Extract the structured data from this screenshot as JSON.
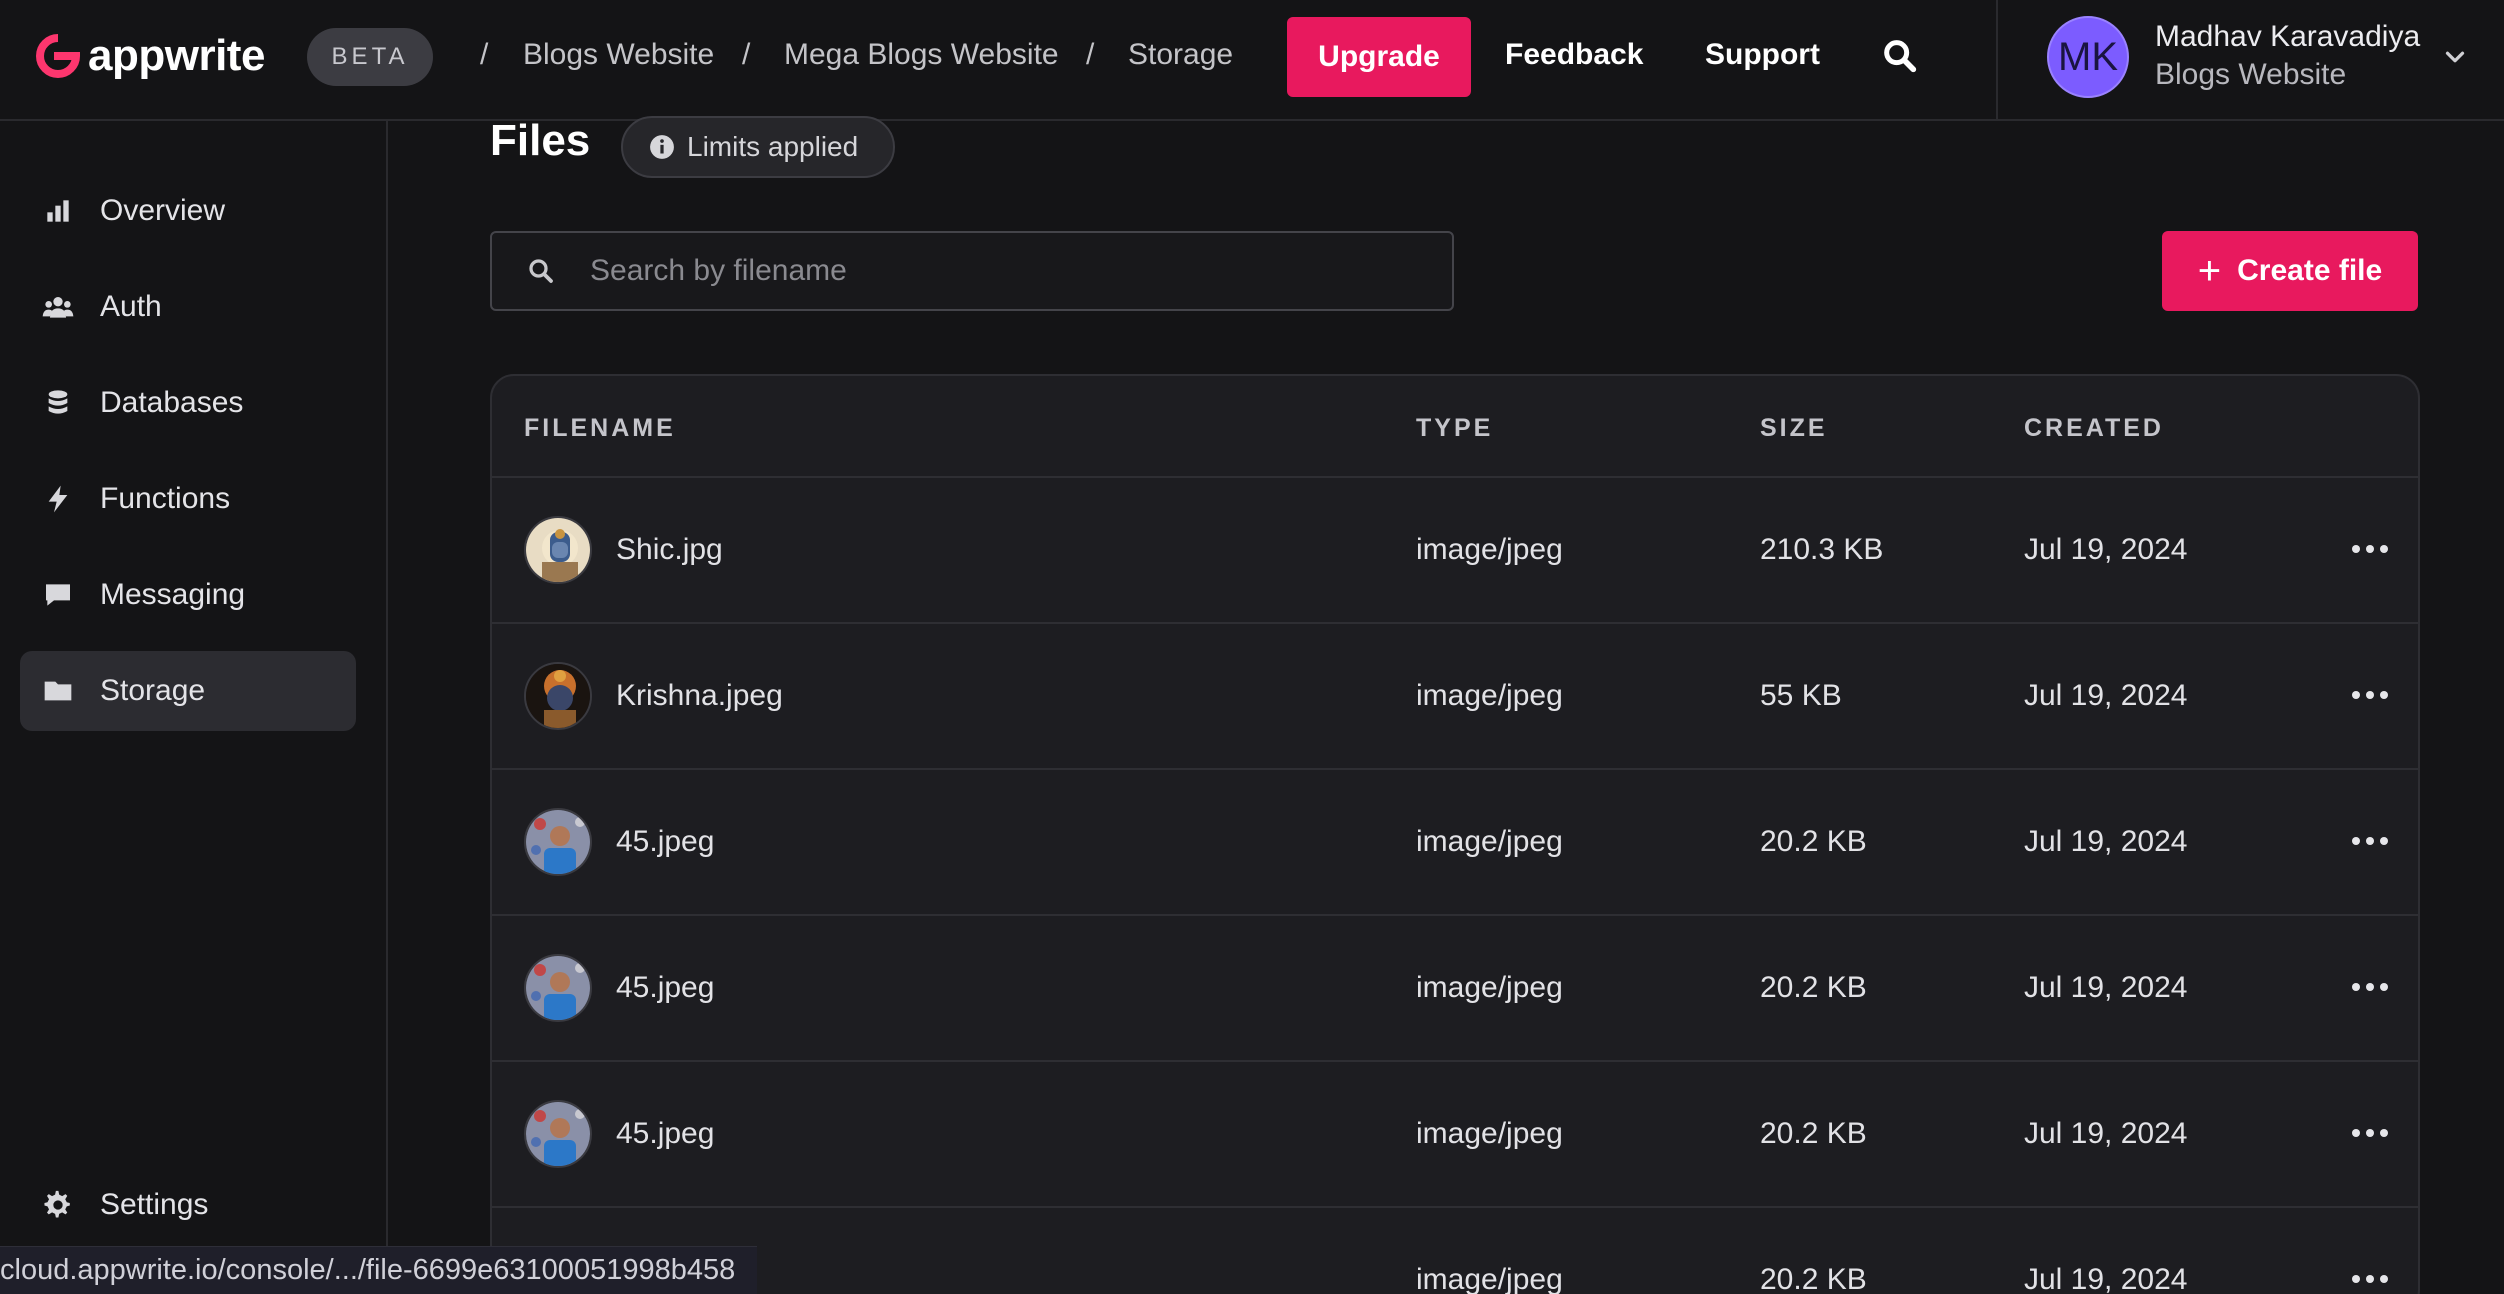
{
  "header": {
    "logo_text": "appwrite",
    "beta_label": "BETA",
    "breadcrumbs": [
      "Blogs Website",
      "Mega Blogs Website",
      "Storage"
    ],
    "upgrade_label": "Upgrade",
    "feedback_label": "Feedback",
    "support_label": "Support",
    "user": {
      "initials": "MK",
      "name": "Madhav Karavadiya",
      "project": "Blogs Website"
    }
  },
  "sidebar": {
    "items": [
      {
        "label": "Overview",
        "icon": "chart-bar-icon"
      },
      {
        "label": "Auth",
        "icon": "users-icon"
      },
      {
        "label": "Databases",
        "icon": "database-icon"
      },
      {
        "label": "Functions",
        "icon": "lightning-icon"
      },
      {
        "label": "Messaging",
        "icon": "chat-icon"
      },
      {
        "label": "Storage",
        "icon": "folder-icon",
        "active": true
      }
    ],
    "settings_label": "Settings"
  },
  "main": {
    "title": "Files",
    "limits_label": "Limits applied",
    "search_placeholder": "Search by filename",
    "create_label": "Create file",
    "columns": [
      "FILENAME",
      "TYPE",
      "SIZE",
      "CREATED"
    ],
    "rows": [
      {
        "name": "Shic.jpg",
        "type": "image/jpeg",
        "size": "210.3 KB",
        "created": "Jul 19, 2024"
      },
      {
        "name": "Krishna.jpeg",
        "type": "image/jpeg",
        "size": "55 KB",
        "created": "Jul 19, 2024"
      },
      {
        "name": "45.jpeg",
        "type": "image/jpeg",
        "size": "20.2 KB",
        "created": "Jul 19, 2024"
      },
      {
        "name": "45.jpeg",
        "type": "image/jpeg",
        "size": "20.2 KB",
        "created": "Jul 19, 2024"
      },
      {
        "name": "45.jpeg",
        "type": "image/jpeg",
        "size": "20.2 KB",
        "created": "Jul 19, 2024"
      },
      {
        "name": "",
        "type": "image/jpeg",
        "size": "20.2 KB",
        "created": "Jul 19, 2024"
      }
    ]
  },
  "status_url": "cloud.appwrite.io/console/.../file-6699e63100051998b458",
  "colors": {
    "accent": "#e8195e",
    "background": "#141416",
    "surface": "#1d1d21",
    "avatar": "#7c5cff"
  }
}
